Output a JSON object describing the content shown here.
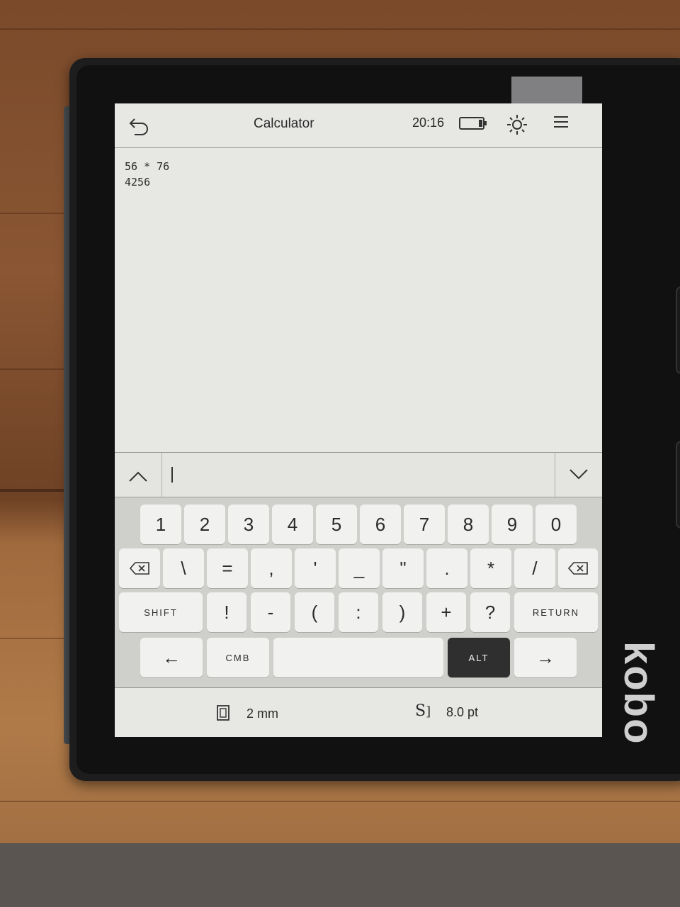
{
  "app": {
    "title": "Calculator",
    "time": "20:16"
  },
  "output": {
    "expression": "56 * 76",
    "result": "4256"
  },
  "input": {
    "value": ""
  },
  "keyboard": {
    "row1": [
      "1",
      "2",
      "3",
      "4",
      "5",
      "6",
      "7",
      "8",
      "9",
      "0"
    ],
    "row2": [
      "\\",
      "=",
      ",",
      "'",
      "_",
      "\"",
      ".",
      "*",
      "/"
    ],
    "row3": [
      "!",
      "-",
      "(",
      ":",
      ")",
      "+",
      "?"
    ],
    "shift_label": "SHIFT",
    "return_label": "RETURN",
    "cmb_label": "CMB",
    "alt_label": "ALT",
    "left_arrow": "←",
    "right_arrow": "→"
  },
  "settings": {
    "margin": "2 mm",
    "font_size": "8.0 pt"
  },
  "device": {
    "brand": "kobo"
  }
}
